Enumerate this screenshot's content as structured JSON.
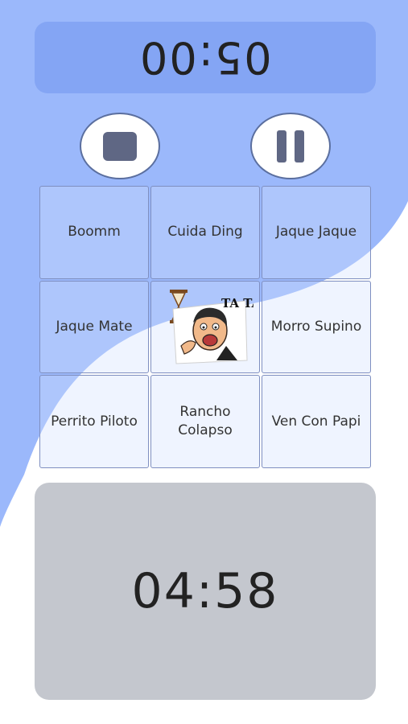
{
  "top_timer": {
    "value": "05:00"
  },
  "controls": {
    "stop_icon": "stop-icon",
    "pause_icon": "pause-icon"
  },
  "sound_grid": {
    "cells": [
      {
        "label": "Boomm"
      },
      {
        "label": "Cuida Ding"
      },
      {
        "label": "Jaque Jaque"
      },
      {
        "label": "Jaque Mate"
      },
      {
        "label": "TA TA TA TA"
      },
      {
        "label": "Morro Supino"
      },
      {
        "label": "Perrito Piloto"
      },
      {
        "label": "Rancho Colapso"
      },
      {
        "label": "Ven Con Papi"
      }
    ]
  },
  "bottom_timer": {
    "value": "04:58"
  },
  "colors": {
    "accent_blue": "#84a5f4",
    "wave_blue": "#9bb8fb",
    "bottom_panel": "#c4c7ce",
    "icon_gray": "#5f6784"
  }
}
